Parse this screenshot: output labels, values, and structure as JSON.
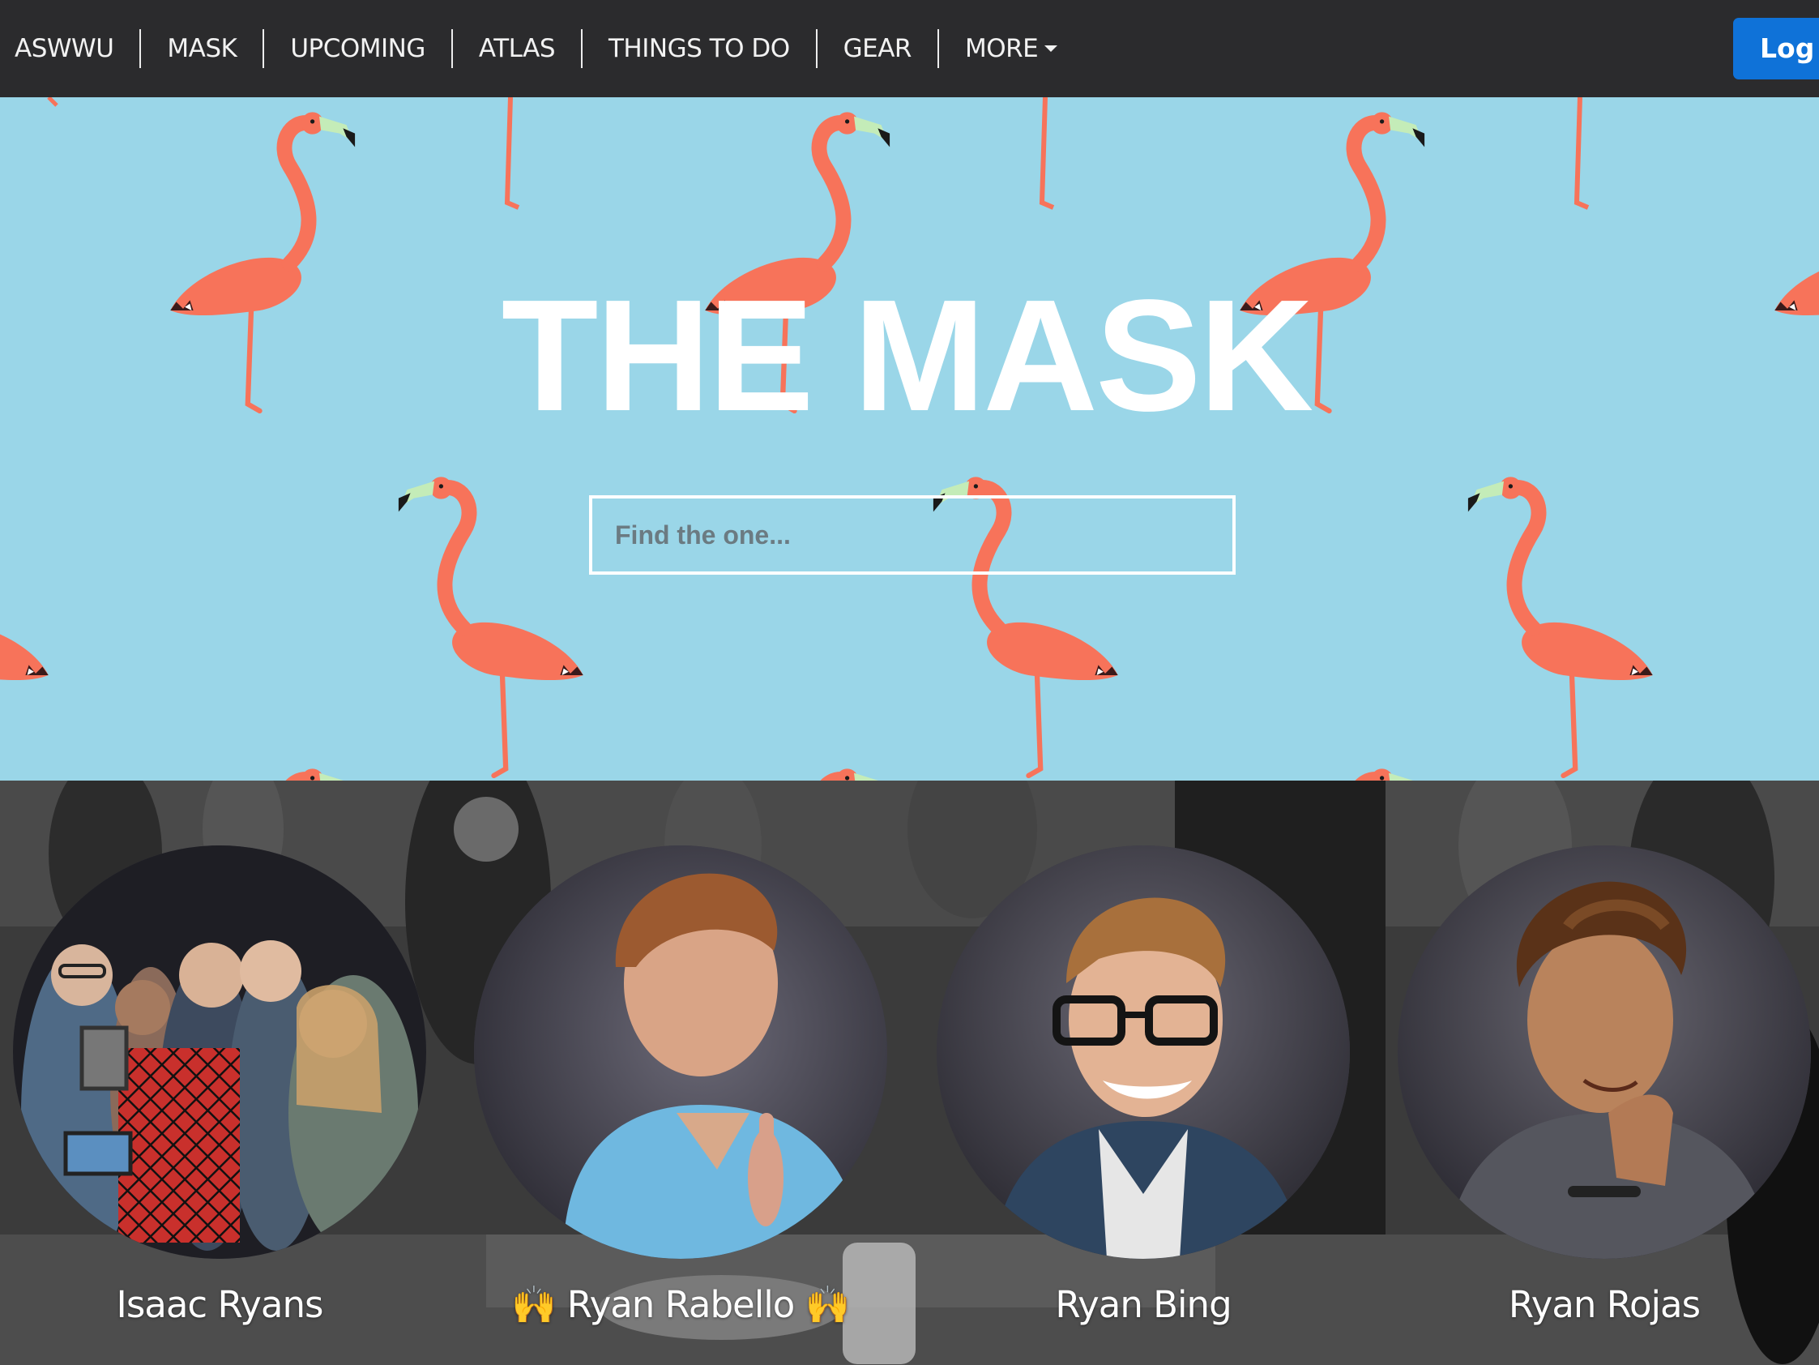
{
  "nav": {
    "items": [
      {
        "label": "ASWWU"
      },
      {
        "label": "MASK"
      },
      {
        "label": "UPCOMING"
      },
      {
        "label": "ATLAS"
      },
      {
        "label": "THINGS TO DO"
      },
      {
        "label": "GEAR"
      },
      {
        "label": "MORE"
      }
    ],
    "login_label": "Log in"
  },
  "hero": {
    "title": "THE MASK",
    "search_placeholder": "Find the one...",
    "background_color": "#9ad6e8",
    "flamingo_color": "#f7735a"
  },
  "people": [
    {
      "name": "Isaac Ryans"
    },
    {
      "name": "🙌 Ryan Rabello 🙌"
    },
    {
      "name": "Ryan Bing"
    },
    {
      "name": "Ryan Rojas"
    }
  ],
  "colors": {
    "navbar": "#2b2b2d",
    "login_button": "#0f72d8"
  }
}
